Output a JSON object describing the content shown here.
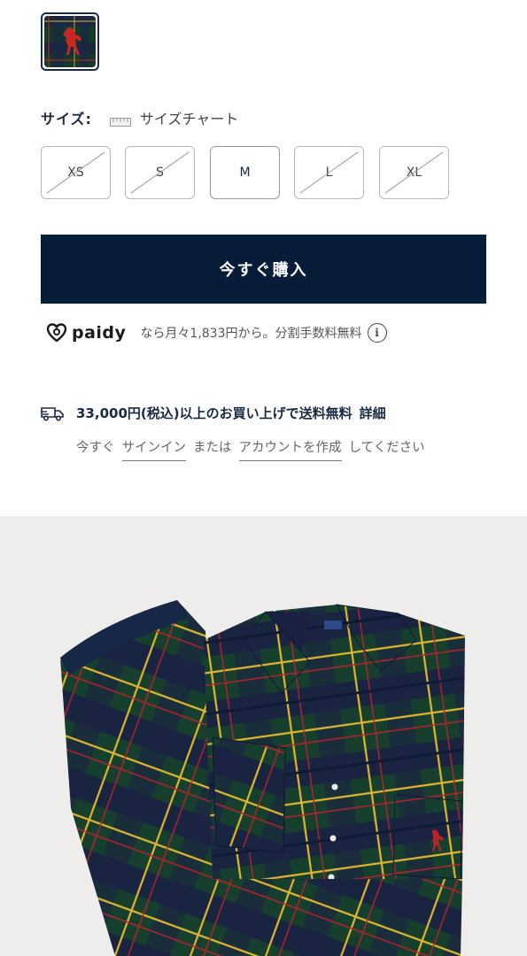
{
  "swatch": {
    "icon": "polo-pony-plaid-swatch",
    "colors": [
      "#143a2c",
      "#1b2446",
      "#c8281f",
      "#e3b93a"
    ]
  },
  "size": {
    "label": "サイズ:",
    "chart_link": "サイズチャート",
    "options": [
      {
        "label": "XS",
        "available": false
      },
      {
        "label": "S",
        "available": false
      },
      {
        "label": "M",
        "available": true
      },
      {
        "label": "L",
        "available": false
      },
      {
        "label": "XL",
        "available": false
      }
    ]
  },
  "buy_button": {
    "label": "今すぐ購入",
    "color": "#061c38"
  },
  "paidy": {
    "brand": "paidy",
    "text": "なら月々1,833円から。分割手数料無料",
    "info_icon": "i"
  },
  "shipping": {
    "text": "33,000円(税込)以上のお買い上げで送料無料",
    "details": "詳細"
  },
  "signin": {
    "prefix": "今すぐ",
    "signin_link": "サインイン",
    "middle": "または",
    "create_link": "アカウントを作成",
    "suffix": "してください"
  },
  "product_image": {
    "alt_icon": "plaid-pajama-set-image",
    "colors": {
      "background": "#efedeb",
      "green": "#163f2e",
      "navy": "#1a2143",
      "yellow": "#e0b531",
      "red": "#b8232a"
    }
  }
}
